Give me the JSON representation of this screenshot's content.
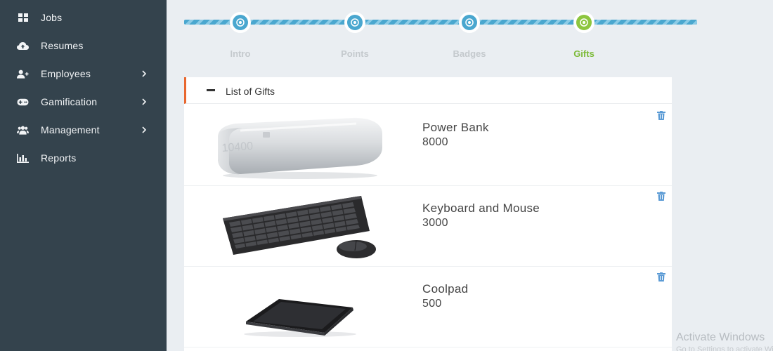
{
  "sidebar": {
    "items": [
      {
        "label": "Jobs",
        "icon": "grid-icon",
        "has_submenu": false
      },
      {
        "label": "Resumes",
        "icon": "cloud-upload-icon",
        "has_submenu": false
      },
      {
        "label": "Employees",
        "icon": "user-plus-icon",
        "has_submenu": true
      },
      {
        "label": "Gamification",
        "icon": "gamepad-icon",
        "has_submenu": true
      },
      {
        "label": "Management",
        "icon": "users-icon",
        "has_submenu": true
      },
      {
        "label": "Reports",
        "icon": "bar-chart-icon",
        "has_submenu": false
      }
    ]
  },
  "stepper": {
    "steps": [
      {
        "label": "Intro",
        "state": "done"
      },
      {
        "label": "Points",
        "state": "done"
      },
      {
        "label": "Badges",
        "state": "done"
      },
      {
        "label": "Gifts",
        "state": "active"
      }
    ],
    "colors": {
      "done": "#4aa7cf",
      "active": "#8dc63f",
      "inactive_label": "#c4c9cd",
      "active_label": "#7dbb3a"
    }
  },
  "panel": {
    "title": "List of Gifts",
    "accent": "#e8672f",
    "gifts": [
      {
        "name": "Power Bank",
        "points": "8000",
        "image": "power-bank"
      },
      {
        "name": "Keyboard and Mouse",
        "points": "3000",
        "image": "keyboard-mouse"
      },
      {
        "name": "Coolpad",
        "points": "500",
        "image": "coolpad"
      }
    ]
  },
  "watermark": {
    "line1": "Activate Windows",
    "line2": "Go to Settings to activate Windows."
  }
}
